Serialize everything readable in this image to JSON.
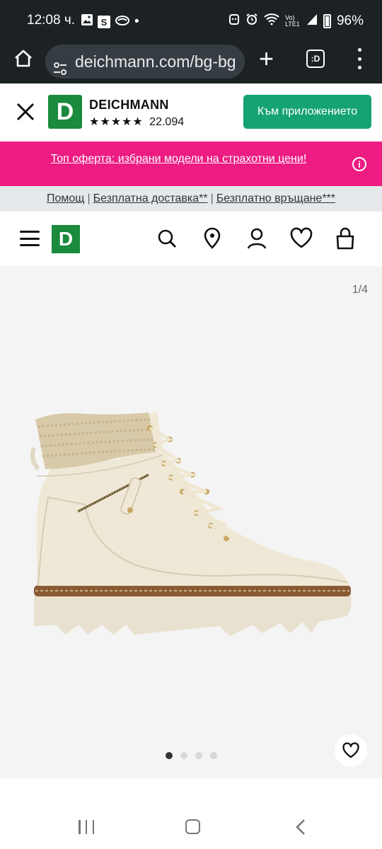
{
  "status_bar": {
    "time": "12:08 ч.",
    "s_badge": "S",
    "dot": "•",
    "network": "Vo) LTE1",
    "battery": "96%",
    "icons": [
      "gallery-icon",
      "s-icon",
      "cloud-icon",
      "face-icon",
      "alarm-icon",
      "wifi-icon",
      "signal-icon",
      "battery-icon"
    ]
  },
  "browser": {
    "url": "deichmann.com/bg-bg",
    "new_tab": "+",
    "tab_label": ":D"
  },
  "app_banner": {
    "name": "DEICHMANN",
    "stars": "★★★★★",
    "rating_count": "22.094",
    "logo_letter": "D",
    "open_button": "Към приложението"
  },
  "promo": {
    "text": "Топ оферта: избрани модели на страхотни цени!",
    "info": "i",
    "background": "#ec1c82"
  },
  "service_links": [
    "Помощ",
    "Безплатна доставка**",
    "Безплатно връщане***"
  ],
  "header": {
    "logo_letter": "D",
    "icons": [
      "search-icon",
      "store-locator-icon",
      "account-icon",
      "wishlist-icon",
      "cart-icon"
    ]
  },
  "gallery": {
    "counter": "1/4",
    "image_alt": "beige lace-up ankle boot with knit collar",
    "slides": 4,
    "active_slide": 1
  },
  "colors": {
    "brand_green": "#1a8a3c",
    "button_green": "#16a374",
    "status_bg": "#1c2124"
  }
}
